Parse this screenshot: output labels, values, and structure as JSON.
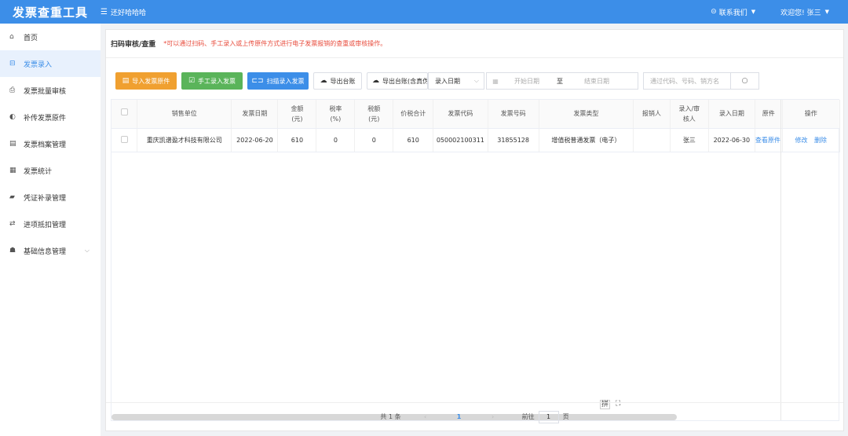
{
  "header": {
    "logo": "发票查重工具",
    "greeting_icon": "menu-lines-icon",
    "greeting": "还好哈哈哈",
    "contact": "联系我们",
    "welcome": "欢迎您! 张三"
  },
  "sidebar": {
    "items": [
      {
        "label": "首页",
        "icon": "home-icon"
      },
      {
        "label": "发票录入",
        "icon": "input-icon",
        "active": true
      },
      {
        "label": "发票批量审核",
        "icon": "batch-icon"
      },
      {
        "label": "补传发票原件",
        "icon": "upload-icon"
      },
      {
        "label": "发票档案管理",
        "icon": "archive-icon"
      },
      {
        "label": "发票统计",
        "icon": "stats-icon"
      },
      {
        "label": "凭证补录管理",
        "icon": "voucher-icon"
      },
      {
        "label": "进项抵扣管理",
        "icon": "deduct-icon"
      },
      {
        "label": "基础信息管理",
        "icon": "org-icon",
        "expandable": true
      }
    ]
  },
  "main": {
    "title": "扫码审核/查重",
    "hint": "*可以通过扫码、手工录入或上传原件方式进行电子发票报销的查重或审核操作。"
  },
  "toolbar": {
    "import_label": "导入发票原件",
    "manual_label": "手工录入发票",
    "scan_label": "扫描录入发票",
    "export_label": "导出台账",
    "export_full_label": "导出台账(含真伪)",
    "date_type": "录入日期",
    "start_placeholder": "开始日期",
    "range_sep": "至",
    "end_placeholder": "结束日期",
    "search_placeholder": "通过代码、号码、销方名"
  },
  "table": {
    "headers": {
      "seller": "销售单位",
      "date": "发票日期",
      "amount": "金额\n(元)",
      "rate": "税率\n(%)",
      "tax": "税额\n(元)",
      "total": "价税合计",
      "code": "发票代码",
      "number": "发票号码",
      "type": "发票类型",
      "reimburser": "报销人",
      "reviewer": "录入/审\n核人",
      "entry_date": "录入日期",
      "original": "原件",
      "ops": "操作"
    },
    "rows": [
      {
        "seller": "重庆凯谱盈才科技有限公司",
        "date": "2022-06-20",
        "amount": "610",
        "rate": "0",
        "tax": "0",
        "total": "610",
        "code": "050002100311",
        "number": "31855128",
        "type": "增值税普通发票（电子）",
        "reimburser": "",
        "reviewer": "张三",
        "entry_date": "2022-06-30",
        "original": "查看原件",
        "edit": "修改",
        "delete": "删除"
      }
    ]
  },
  "table_icons": {
    "left": "拼",
    "right": "⛶"
  },
  "pagination": {
    "total": "共 1 条",
    "current": "1",
    "goto_label": "前往",
    "goto_value": "1",
    "page_unit": "页"
  }
}
